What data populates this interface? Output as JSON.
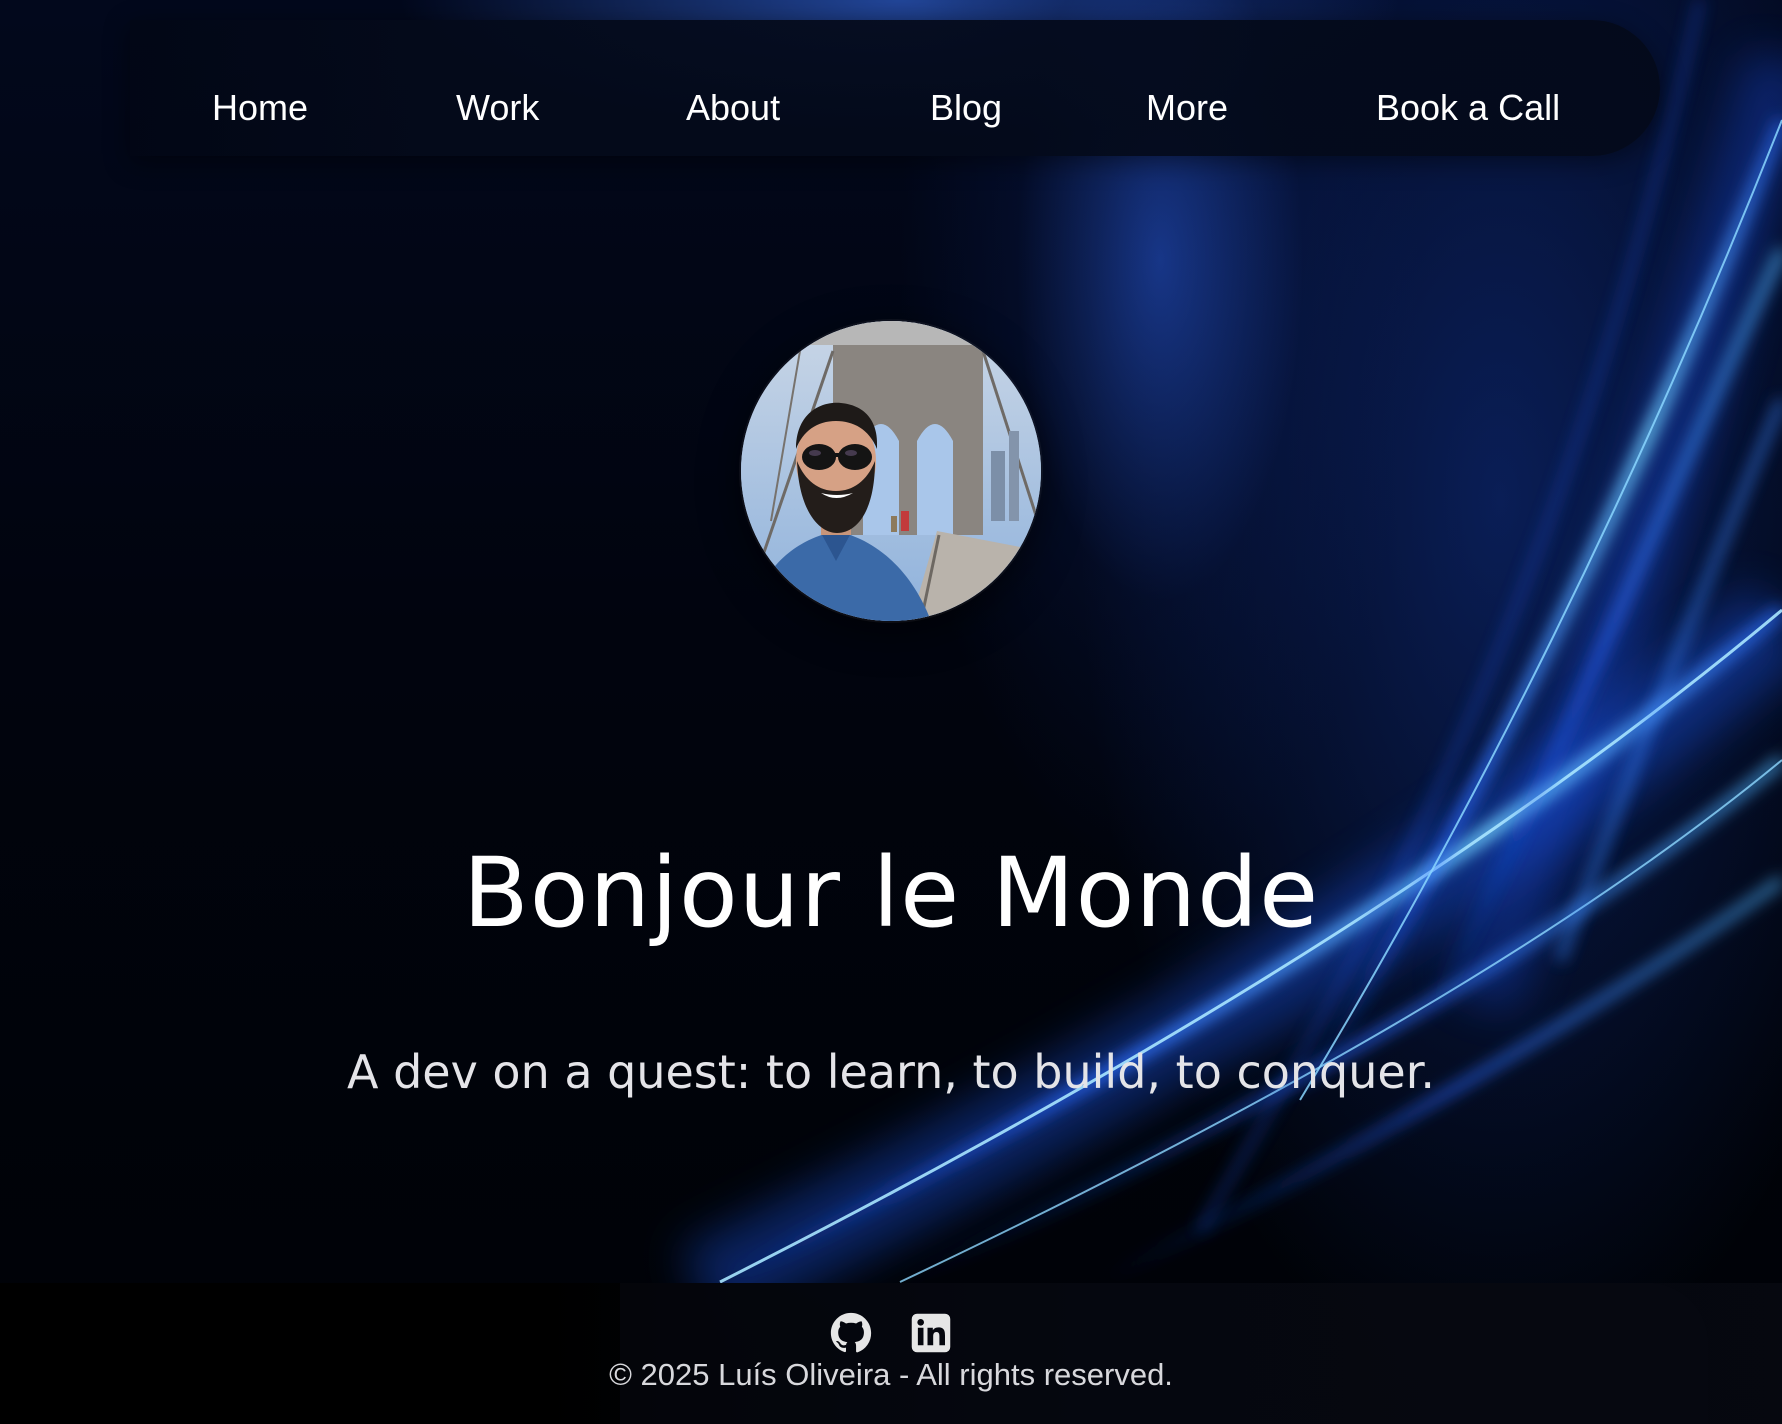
{
  "nav": {
    "items": [
      {
        "label": "Home"
      },
      {
        "label": "Work"
      },
      {
        "label": "About"
      },
      {
        "label": "Blog"
      },
      {
        "label": "More"
      },
      {
        "label": "Book a Call"
      }
    ]
  },
  "hero": {
    "title": "Bonjour le Monde",
    "subtitle": "A dev on a quest: to learn, to build, to conquer."
  },
  "footer": {
    "social": [
      {
        "icon": "github-icon"
      },
      {
        "icon": "linkedin-icon"
      }
    ],
    "copyright": "© 2025 Luís Oliveira - All rights reserved."
  },
  "colors": {
    "background": "#000208",
    "accent": "#2f7bff",
    "text": "#ffffff"
  }
}
